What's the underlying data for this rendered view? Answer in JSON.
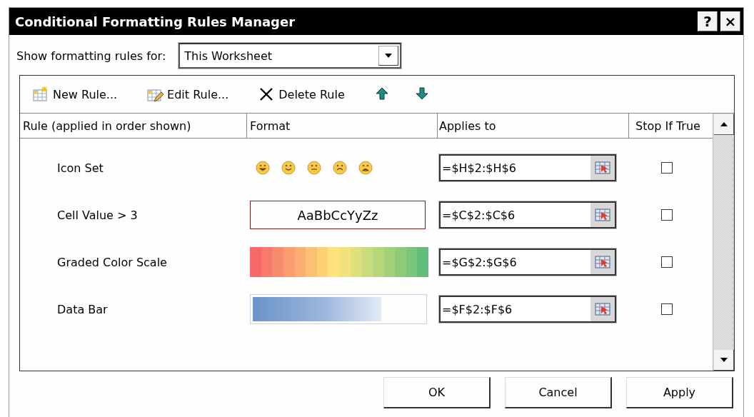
{
  "window": {
    "title": "Conditional Formatting Rules Manager",
    "title_buttons": [
      "?",
      "×"
    ]
  },
  "scope": {
    "label": "Show formatting rules for:",
    "value": "This Worksheet"
  },
  "toolbar": [
    {
      "kind": "new",
      "label": "New Rule..."
    },
    {
      "kind": "edit",
      "label": "Edit Rule..."
    },
    {
      "kind": "delete",
      "label": "Delete Rule"
    },
    {
      "kind": "up"
    },
    {
      "kind": "down"
    }
  ],
  "table": {
    "columns": [
      "Rule (applied in order shown)",
      "Format",
      "Applies to",
      "Stop If True"
    ],
    "rows": [
      {
        "rule": "Icon Set",
        "kind": "icon_set",
        "applies_to": "=$H$2:$H$6",
        "stop_if_true": false
      },
      {
        "rule": "Cell Value > 3",
        "kind": "font",
        "sample": "AaBbCcYyZz",
        "applies_to": "=$C$2:$C$6",
        "stop_if_true": false
      },
      {
        "rule": "Graded Color Scale",
        "kind": "color_scale",
        "applies_to": "=$G$2:$G$6",
        "stop_if_true": false
      },
      {
        "rule": "Data Bar",
        "kind": "data_bar",
        "level": 0.75,
        "applies_to": "=$F$2:$F$6",
        "stop_if_true": false
      }
    ]
  },
  "buttons": [
    "OK",
    "Cancel",
    "Apply"
  ]
}
